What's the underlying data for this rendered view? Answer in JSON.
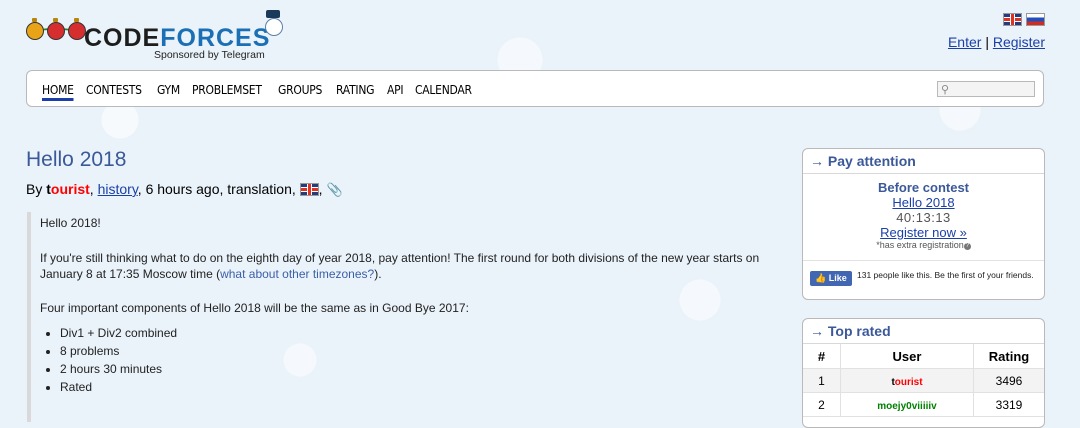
{
  "header": {
    "logo_word_1": "CODE",
    "logo_word_2": "FORCES",
    "sponsor": "Sponsored by Telegram",
    "enter": "Enter",
    "separator": "|",
    "register": "Register"
  },
  "nav": {
    "items": [
      "HOME",
      "CONTESTS",
      "GYM",
      "PROBLEMSET",
      "GROUPS",
      "RATING",
      "API",
      "CALENDAR"
    ],
    "active": "HOME",
    "search_icon": "search-icon"
  },
  "post": {
    "title": "Hello 2018",
    "by": "By",
    "author_first": "t",
    "author_rest": "ourist",
    "history": "history",
    "time": "6 hours ago, translation,",
    "comma": ",",
    "p1": "Hello 2018!",
    "p2_text": "If you're still thinking what to do on the eighth day of year 2018, pay attention! The first round for both divisions of the new year starts on January 8 at 17:35 Moscow time (",
    "p2_link": "what about other timezones?",
    "p2_end": ").",
    "p3": "Four important components of Hello 2018 will be the same as in Good Bye 2017:",
    "bullets": [
      "Div1 + Div2 combined",
      "8 problems",
      "2 hours 30 minutes",
      "Rated"
    ]
  },
  "pay_attention": {
    "title": "→ Pay attention",
    "before": "Before contest",
    "contest": "Hello 2018",
    "timer": "40:13:13",
    "register_now": "Register now »",
    "extra": "*has extra registration",
    "fb_like": "Like",
    "fb_text": "131 people like this. Be the first of your friends."
  },
  "top_rated": {
    "title": "→ Top rated",
    "headers": [
      "#",
      "User",
      "Rating"
    ],
    "rows": [
      {
        "rank": "1",
        "user_first": "t",
        "user_rest": "ourist",
        "rating": "3496"
      },
      {
        "rank": "2",
        "user": "moejy0viiiiiv",
        "rating": "3319"
      }
    ]
  },
  "colors": {
    "link": "#1a3fa8",
    "title_blue": "#3b5998",
    "legendary_red": "#ff0000",
    "green": "#008000"
  }
}
